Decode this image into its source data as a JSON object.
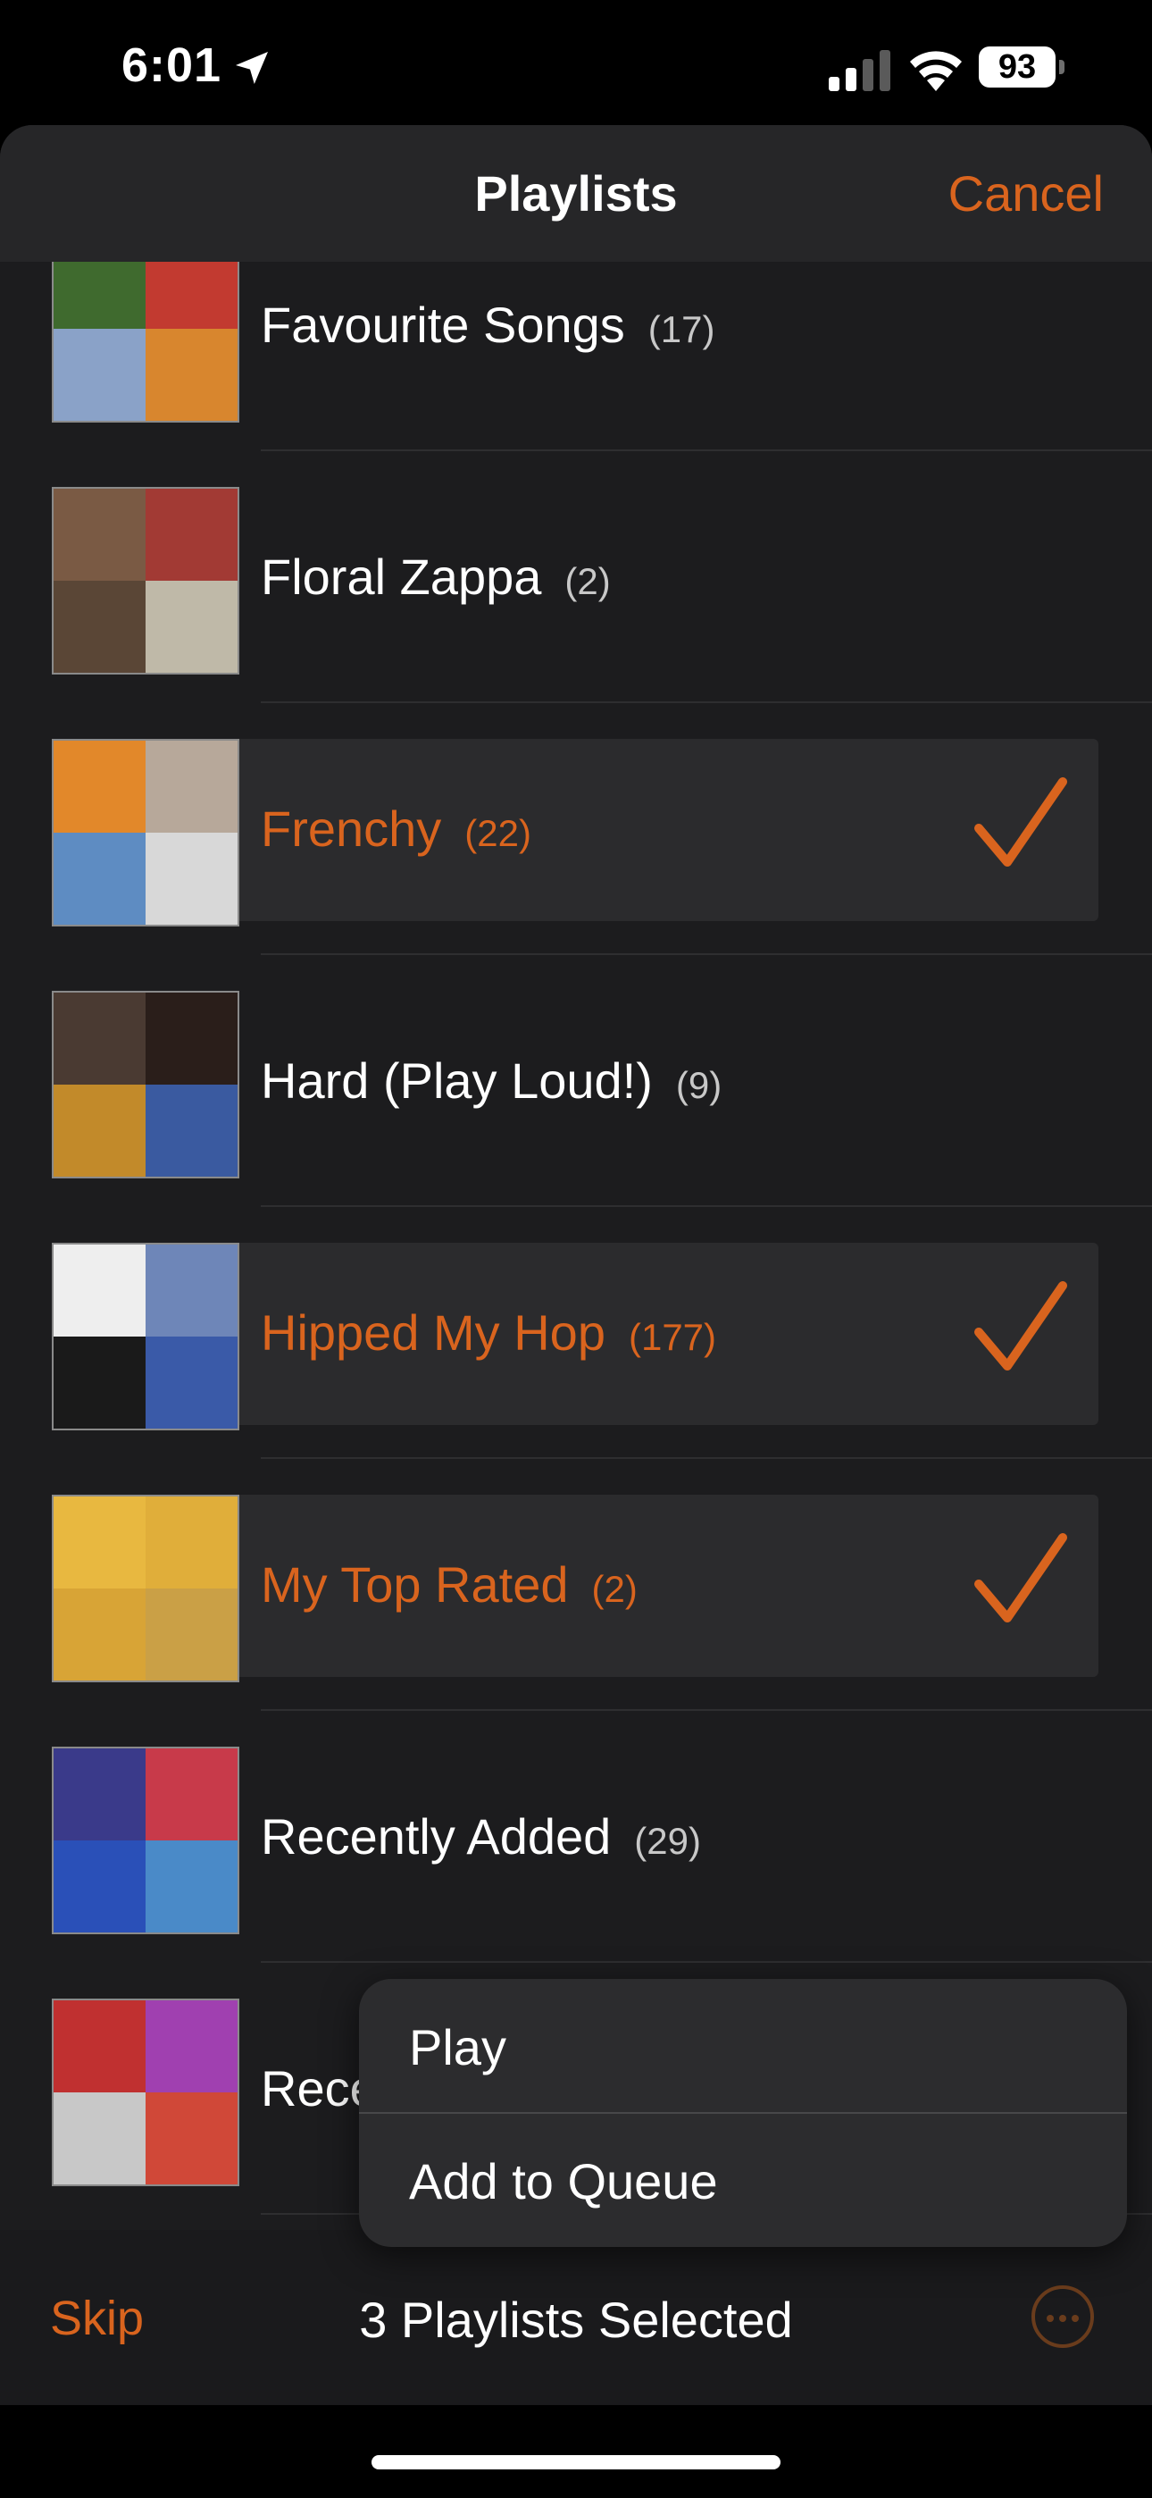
{
  "status_bar": {
    "time": "6:01",
    "battery": "93"
  },
  "header": {
    "title": "Playlists",
    "cancel": "Cancel"
  },
  "playlists": [
    {
      "name": "Favourite Songs",
      "count": "(17)",
      "selected": false,
      "art": [
        "#3f6a2e",
        "#c23a30",
        "#8aa2c8",
        "#d8862e"
      ]
    },
    {
      "name": "Floral Zappa",
      "count": "(2)",
      "selected": false,
      "art": [
        "#7a5a44",
        "#a23a34",
        "#5a4636",
        "#bfb9a8"
      ]
    },
    {
      "name": "Frenchy",
      "count": "(22)",
      "selected": true,
      "art": [
        "#e2882a",
        "#b7a89a",
        "#5e8cc2",
        "#d8d8d8"
      ]
    },
    {
      "name": "Hard (Play Loud!)",
      "count": "(9)",
      "selected": false,
      "art": [
        "#4a3a32",
        "#2a1e1a",
        "#c28a2a",
        "#3a5aa0"
      ]
    },
    {
      "name": "Hipped My Hop",
      "count": "(177)",
      "selected": true,
      "art": [
        "#eeeeee",
        "#6e86b8",
        "#1a1a1a",
        "#3a5aa8"
      ]
    },
    {
      "name": "My Top Rated",
      "count": "(2)",
      "selected": true,
      "art": [
        "#e8b840",
        "#e0ae3a",
        "#d8a436",
        "#caa046"
      ]
    },
    {
      "name": "Recently Added",
      "count": "(29)",
      "selected": false,
      "art": [
        "#3a3a8a",
        "#c83a4a",
        "#2a50b8",
        "#4a8ac8"
      ]
    },
    {
      "name": "Rece",
      "count": "",
      "selected": false,
      "art": [
        "#c03030",
        "#a040b0",
        "#c8c8c8",
        "#d04838"
      ]
    }
  ],
  "context_menu": {
    "play": "Play",
    "add_to_queue": "Add to Queue"
  },
  "bottom_bar": {
    "skip": "Skip",
    "selected_text": "3 Playlists Selected"
  },
  "colors": {
    "accent": "#d9641e",
    "background": "#1c1c1e"
  }
}
